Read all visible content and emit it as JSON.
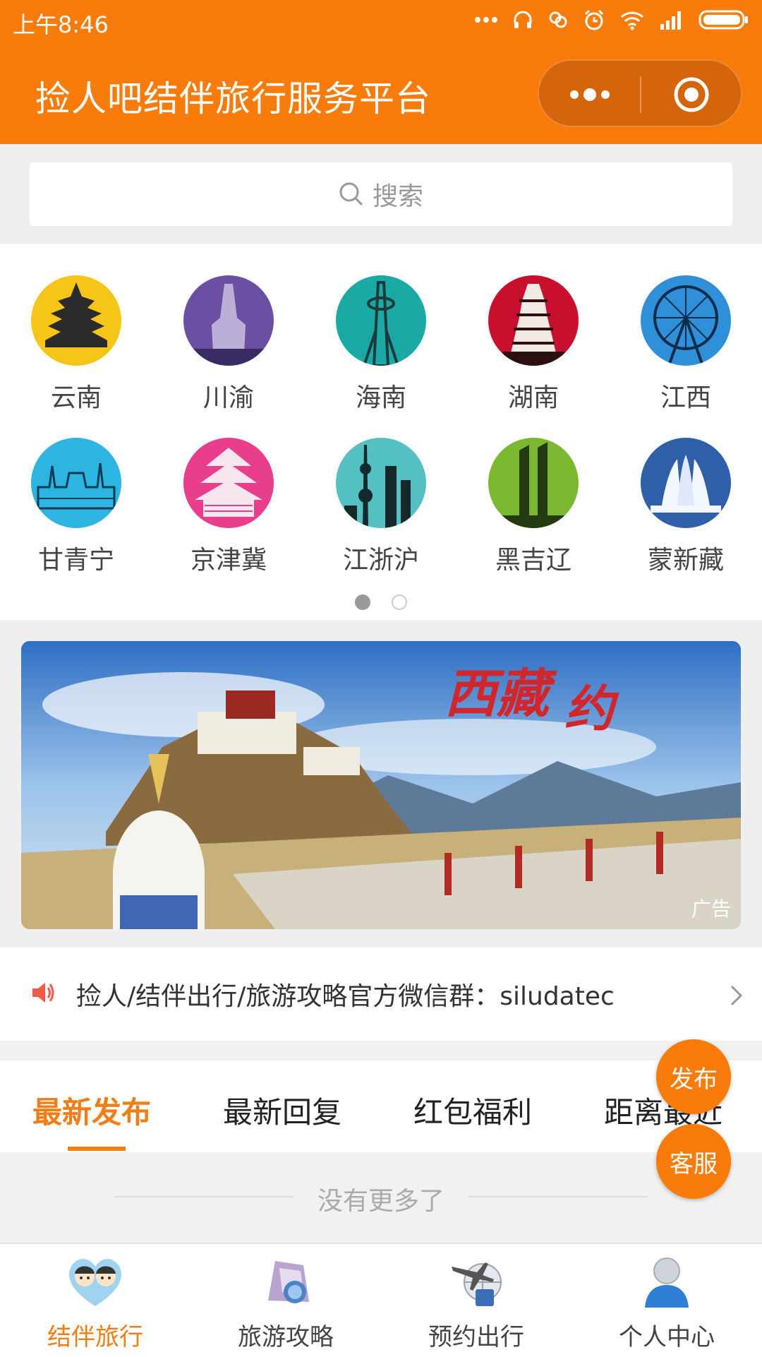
{
  "status_bar": {
    "time": "上午8:46"
  },
  "header": {
    "title": "捡人吧结伴旅行服务平台"
  },
  "search": {
    "placeholder": "搜索"
  },
  "regions": [
    {
      "label": "云南",
      "color": "#f5c518"
    },
    {
      "label": "川渝",
      "color": "#6b4fa3"
    },
    {
      "label": "海南",
      "color": "#1aa9a4"
    },
    {
      "label": "湖南",
      "color": "#c8102e"
    },
    {
      "label": "江西",
      "color": "#2f8fd8"
    },
    {
      "label": "甘青宁",
      "color": "#2bb5e0"
    },
    {
      "label": "京津冀",
      "color": "#e83e8c"
    },
    {
      "label": "江浙沪",
      "color": "#54c0c2"
    },
    {
      "label": "黑吉辽",
      "color": "#7cb82f"
    },
    {
      "label": "蒙新藏",
      "color": "#2f5fa8"
    }
  ],
  "pager": {
    "current": 1,
    "total": 2
  },
  "banner": {
    "ad_label": "广告"
  },
  "notice": {
    "text": "捡人/结伴出行/旅游攻略官方微信群：siludatec"
  },
  "tabs": [
    "最新发布",
    "最新回复",
    "红包福利",
    "距离最近"
  ],
  "list_status": "没有更多了",
  "fab": {
    "publish": "发布",
    "service": "客服"
  },
  "bottom_nav": [
    {
      "label": "结伴旅行",
      "active": true
    },
    {
      "label": "旅游攻略",
      "active": false
    },
    {
      "label": "预约出行",
      "active": false
    },
    {
      "label": "个人中心",
      "active": false
    }
  ],
  "colors": {
    "brand": "#f97b0a",
    "active_tab": "#f07d16"
  }
}
